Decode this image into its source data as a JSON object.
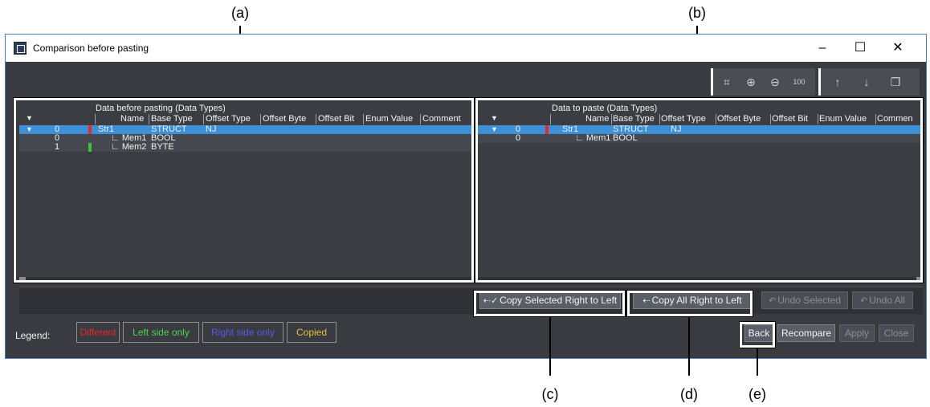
{
  "callouts": {
    "a": "(a)",
    "b": "(b)",
    "c": "(c)",
    "d": "(d)",
    "e": "(e)"
  },
  "window": {
    "title": "Comparison before pasting",
    "minimize": "–",
    "maximize": "☐",
    "close": "✕"
  },
  "toolbar": {
    "icons": [
      "fit-icon",
      "zoom-in-icon",
      "zoom-out-icon",
      "zoom-100-icon",
      "arrow-up-icon",
      "arrow-down-icon",
      "restore-layout-icon"
    ]
  },
  "left_grid": {
    "title": "Data before pasting (Data Types)",
    "columns": [
      "Name",
      "Base Type",
      "Offset Type",
      "Offset Byte",
      "Offset Bit",
      "Enum Value",
      "Comment"
    ],
    "collapse_glyph": "▼",
    "rows": [
      {
        "expander": "▼",
        "index": "0",
        "name": "Str1",
        "base_type": "STRUCT",
        "offset_type": "NJ",
        "marker_color": "#e32b2b"
      },
      {
        "expander": "",
        "index": "0",
        "name": "∟ Mem1",
        "base_type": "BOOL",
        "offset_type": "",
        "marker_color": ""
      },
      {
        "expander": "",
        "index": "1",
        "name": "∟ Mem2",
        "base_type": "BYTE",
        "offset_type": "",
        "marker_color": "#3fc13f"
      }
    ]
  },
  "right_grid": {
    "title": "Data to paste (Data Types)",
    "columns": [
      "Name",
      "Base Type",
      "Offset Type",
      "Offset Byte",
      "Offset Bit",
      "Enum Value",
      "Commen"
    ],
    "collapse_glyph": "▼",
    "rows": [
      {
        "expander": "▼",
        "index": "0",
        "name": "Str1",
        "base_type": "STRUCT",
        "offset_type": "NJ",
        "marker_color": "#e32b2b"
      },
      {
        "expander": "",
        "index": "0",
        "name": "∟ Mem1",
        "base_type": "BOOL",
        "offset_type": "",
        "marker_color": ""
      }
    ]
  },
  "actions": {
    "copy_selected": "Copy Selected Right to Left",
    "copy_all": "Copy All Right to Left",
    "undo_selected": "Undo Selected",
    "undo_all": "Undo All"
  },
  "legend": {
    "label": "Legend:",
    "items": [
      {
        "label": "Different",
        "color": "#e32b2b"
      },
      {
        "label": "Left side only",
        "color": "#4fd24f"
      },
      {
        "label": "Right side only",
        "color": "#5a5ae6"
      },
      {
        "label": "Copied",
        "color": "#e8c23a"
      }
    ]
  },
  "footer": {
    "back": "Back",
    "recompare": "Recompare",
    "apply": "Apply",
    "close": "Close"
  }
}
